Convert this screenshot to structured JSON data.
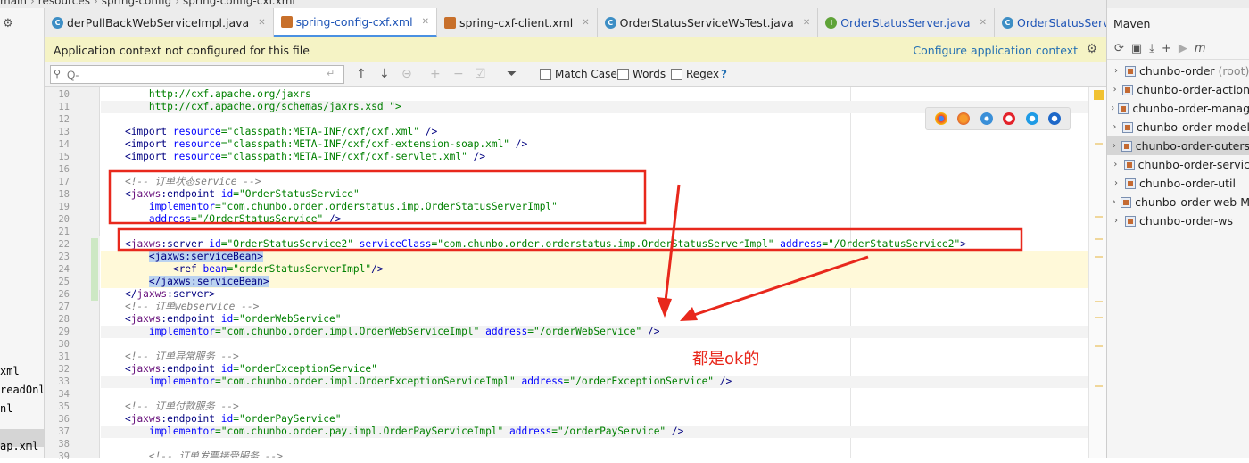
{
  "topbar": {
    "crumb": [
      "main",
      "resources",
      "spring-config",
      "spring-config-cxf.xml"
    ]
  },
  "left_panel": {
    "lines": [
      "xml",
      "readOnly",
      "nl",
      "",
      "ap.xml"
    ]
  },
  "tabs": [
    {
      "label": "derPullBackWebServiceImpl.java",
      "icon": "class-icon",
      "active": false,
      "blue": false
    },
    {
      "label": "spring-config-cxf.xml",
      "icon": "xml-file-icon",
      "active": true,
      "blue": true
    },
    {
      "label": "spring-cxf-client.xml",
      "icon": "xml-file-icon",
      "active": false,
      "blue": false
    },
    {
      "label": "OrderStatusServiceWsTest.java",
      "icon": "class-icon",
      "active": false,
      "blue": false
    },
    {
      "label": "OrderStatusServer.java",
      "icon": "interface-icon",
      "active": false,
      "blue": true
    },
    {
      "label": "OrderStatusServerImpl.java",
      "icon": "class-icon",
      "active": false,
      "blue": true
    }
  ],
  "tab_overflow": "▾≡1",
  "notification": {
    "text": "Application context not configured for this file",
    "link": "Configure application context"
  },
  "findbar": {
    "placeholder": "Q-",
    "options": [
      "Match Case",
      "Words",
      "Regex"
    ],
    "help": "?"
  },
  "editor": {
    "lines": [
      {
        "n": "10",
        "indent": "        ",
        "parts": [
          {
            "t": "http://cxf.apache.org/jaxrs",
            "c": "vl"
          }
        ]
      },
      {
        "n": "11",
        "indent": "        ",
        "parts": [
          {
            "t": "http://cxf.apache.org/schemas/jaxrs.xsd \">",
            "c": "vl"
          }
        ]
      },
      {
        "n": "12",
        "indent": "",
        "parts": []
      },
      {
        "n": "13",
        "indent": "    ",
        "parts": [
          {
            "t": "<import ",
            "c": "tg"
          },
          {
            "t": "resource",
            "c": "at"
          },
          {
            "t": "=\"classpath:META-INF/cxf/cxf.xml\" ",
            "c": "vl"
          },
          {
            "t": "/>",
            "c": "tg"
          }
        ]
      },
      {
        "n": "14",
        "indent": "    ",
        "parts": [
          {
            "t": "<import ",
            "c": "tg"
          },
          {
            "t": "resource",
            "c": "at"
          },
          {
            "t": "=\"classpath:META-INF/cxf/cxf-extension-soap.xml\" ",
            "c": "vl"
          },
          {
            "t": "/>",
            "c": "tg"
          }
        ]
      },
      {
        "n": "15",
        "indent": "    ",
        "parts": [
          {
            "t": "<import ",
            "c": "tg"
          },
          {
            "t": "resource",
            "c": "at"
          },
          {
            "t": "=\"classpath:META-INF/cxf/cxf-servlet.xml\" ",
            "c": "vl"
          },
          {
            "t": "/>",
            "c": "tg"
          }
        ]
      },
      {
        "n": "16",
        "indent": "",
        "parts": []
      },
      {
        "n": "17",
        "indent": "    ",
        "parts": [
          {
            "t": "<!-- 订单状态service -->",
            "c": "cm"
          }
        ]
      },
      {
        "n": "18",
        "indent": "    ",
        "parts": [
          {
            "t": "<",
            "c": "tg"
          },
          {
            "t": "jaxws",
            "c": "ns"
          },
          {
            "t": ":endpoint ",
            "c": "tg"
          },
          {
            "t": "id",
            "c": "at"
          },
          {
            "t": "=\"OrderStatusService\"",
            "c": "vl"
          }
        ]
      },
      {
        "n": "19",
        "indent": "        ",
        "parts": [
          {
            "t": "implementor",
            "c": "at"
          },
          {
            "t": "=\"com.chunbo.order.orderstatus.imp.OrderStatusServerImpl\"",
            "c": "vl"
          }
        ]
      },
      {
        "n": "20",
        "indent": "        ",
        "parts": [
          {
            "t": "address",
            "c": "at"
          },
          {
            "t": "=\"/OrderStatusService\" ",
            "c": "vl"
          },
          {
            "t": "/>",
            "c": "tg"
          }
        ]
      },
      {
        "n": "21",
        "indent": "",
        "parts": []
      },
      {
        "n": "22",
        "indent": "    ",
        "parts": [
          {
            "t": "<",
            "c": "tg"
          },
          {
            "t": "jaxws",
            "c": "ns"
          },
          {
            "t": ":server ",
            "c": "tg"
          },
          {
            "t": "id",
            "c": "at"
          },
          {
            "t": "=\"OrderStatusService2\" ",
            "c": "vl"
          },
          {
            "t": "serviceClass",
            "c": "at"
          },
          {
            "t": "=\"com.chunbo.order.orderstatus.imp.OrderStatusServerImpl\" ",
            "c": "vl"
          },
          {
            "t": "address",
            "c": "at"
          },
          {
            "t": "=\"/OrderStatusService2\"",
            "c": "vl"
          },
          {
            "t": ">",
            "c": "tg"
          }
        ]
      },
      {
        "n": "23",
        "indent": "        ",
        "parts": [
          {
            "t": "<jaxws:serviceBean>",
            "c": "tg tsel"
          }
        ]
      },
      {
        "n": "24",
        "indent": "            ",
        "parts": [
          {
            "t": "<ref ",
            "c": "tg"
          },
          {
            "t": "bean",
            "c": "at"
          },
          {
            "t": "=\"orderStatusServerImpl\"",
            "c": "vl"
          },
          {
            "t": "/>",
            "c": "tg"
          }
        ]
      },
      {
        "n": "25",
        "indent": "        ",
        "parts": [
          {
            "t": "</jaxws:serviceBean>",
            "c": "tg tsel"
          }
        ]
      },
      {
        "n": "26",
        "indent": "    ",
        "parts": [
          {
            "t": "</",
            "c": "tg"
          },
          {
            "t": "jaxws",
            "c": "ns"
          },
          {
            "t": ":server>",
            "c": "tg"
          }
        ]
      },
      {
        "n": "27",
        "indent": "    ",
        "parts": [
          {
            "t": "<!-- 订单webservice -->",
            "c": "cm"
          }
        ]
      },
      {
        "n": "28",
        "indent": "    ",
        "parts": [
          {
            "t": "<",
            "c": "tg"
          },
          {
            "t": "jaxws",
            "c": "ns"
          },
          {
            "t": ":endpoint ",
            "c": "tg"
          },
          {
            "t": "id",
            "c": "at"
          },
          {
            "t": "=\"orderWebService\"",
            "c": "vl"
          }
        ]
      },
      {
        "n": "29",
        "indent": "        ",
        "parts": [
          {
            "t": "implementor",
            "c": "at"
          },
          {
            "t": "=\"com.chunbo.order.impl.OrderWebServiceImpl\" ",
            "c": "vl"
          },
          {
            "t": "address",
            "c": "at"
          },
          {
            "t": "=\"/orderWebService\" ",
            "c": "vl"
          },
          {
            "t": "/>",
            "c": "tg"
          }
        ]
      },
      {
        "n": "30",
        "indent": "",
        "parts": []
      },
      {
        "n": "31",
        "indent": "    ",
        "parts": [
          {
            "t": "<!-- 订单异常服务 -->",
            "c": "cm"
          }
        ]
      },
      {
        "n": "32",
        "indent": "    ",
        "parts": [
          {
            "t": "<",
            "c": "tg"
          },
          {
            "t": "jaxws",
            "c": "ns"
          },
          {
            "t": ":endpoint ",
            "c": "tg"
          },
          {
            "t": "id",
            "c": "at"
          },
          {
            "t": "=\"orderExceptionService\"",
            "c": "vl"
          }
        ]
      },
      {
        "n": "33",
        "indent": "        ",
        "parts": [
          {
            "t": "implementor",
            "c": "at"
          },
          {
            "t": "=\"com.chunbo.order.impl.OrderExceptionServiceImpl\" ",
            "c": "vl"
          },
          {
            "t": "address",
            "c": "at"
          },
          {
            "t": "=\"/orderExceptionService\" ",
            "c": "vl"
          },
          {
            "t": "/>",
            "c": "tg"
          }
        ]
      },
      {
        "n": "34",
        "indent": "",
        "parts": []
      },
      {
        "n": "35",
        "indent": "    ",
        "parts": [
          {
            "t": "<!-- 订单付款服务 -->",
            "c": "cm"
          }
        ]
      },
      {
        "n": "36",
        "indent": "    ",
        "parts": [
          {
            "t": "<",
            "c": "tg"
          },
          {
            "t": "jaxws",
            "c": "ns"
          },
          {
            "t": ":endpoint ",
            "c": "tg"
          },
          {
            "t": "id",
            "c": "at"
          },
          {
            "t": "=\"orderPayService\"",
            "c": "vl"
          }
        ]
      },
      {
        "n": "37",
        "indent": "        ",
        "parts": [
          {
            "t": "implementor",
            "c": "at"
          },
          {
            "t": "=\"com.chunbo.order.pay.impl.OrderPayServiceImpl\" ",
            "c": "vl"
          },
          {
            "t": "address",
            "c": "at"
          },
          {
            "t": "=\"/orderPayService\" ",
            "c": "vl"
          },
          {
            "t": "/>",
            "c": "tg"
          }
        ]
      },
      {
        "n": "38",
        "indent": "",
        "parts": []
      },
      {
        "n": "39",
        "indent": "        ",
        "parts": [
          {
            "t": "<!-- 订单发票接受服务 -->",
            "c": "cm"
          }
        ]
      }
    ]
  },
  "browsers": [
    "chrome-icon",
    "firefox-icon",
    "safari-icon",
    "opera-icon",
    "ie-icon",
    "edge-icon"
  ],
  "maven": {
    "title": "Maven",
    "items": [
      {
        "label": "chunbo-order",
        "suffix": "(root)",
        "selected": false
      },
      {
        "label": "chunbo-order-action",
        "suffix": "",
        "selected": false
      },
      {
        "label": "chunbo-order-manag",
        "suffix": "",
        "selected": false
      },
      {
        "label": "chunbo-order-model",
        "suffix": "",
        "selected": false
      },
      {
        "label": "chunbo-order-outers",
        "suffix": "",
        "selected": true
      },
      {
        "label": "chunbo-order-servic",
        "suffix": "",
        "selected": false
      },
      {
        "label": "chunbo-order-util",
        "suffix": "",
        "selected": false
      },
      {
        "label": "chunbo-order-web M",
        "suffix": "",
        "selected": false
      },
      {
        "label": "chunbo-order-ws",
        "suffix": "",
        "selected": false
      }
    ]
  },
  "annotation": {
    "note": "都是ok的",
    "color": "#e8281c"
  }
}
